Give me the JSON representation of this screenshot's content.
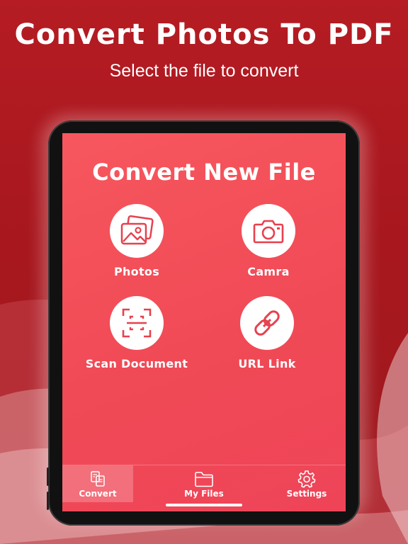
{
  "promo": {
    "title": "Convert Photos To PDF",
    "subtitle": "Select the file to convert"
  },
  "screen": {
    "title": "Convert New File",
    "options": [
      {
        "label": "Photos",
        "icon": "photos-icon"
      },
      {
        "label": "Camra",
        "icon": "camera-icon"
      },
      {
        "label": "Scan Document",
        "icon": "scan-document-icon"
      },
      {
        "label": "URL Link",
        "icon": "link-icon"
      }
    ]
  },
  "tabs": [
    {
      "label": "Convert",
      "icon": "convert-icon",
      "active": true
    },
    {
      "label": "My Files",
      "icon": "folder-icon",
      "active": false
    },
    {
      "label": "Settings",
      "icon": "gear-icon",
      "active": false
    }
  ],
  "colors": {
    "background": "#b51c23",
    "screen": "#f04a56",
    "icon_accent": "#e8404e"
  }
}
